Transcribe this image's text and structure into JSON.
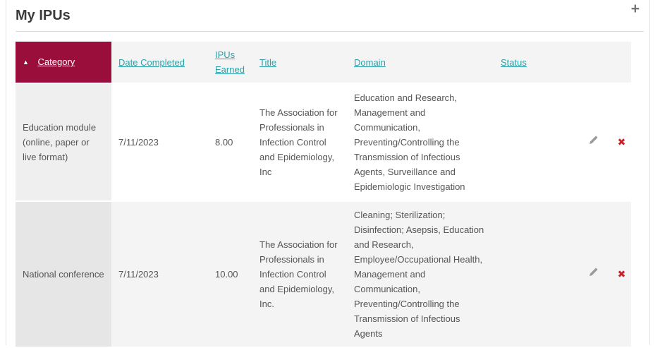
{
  "panel": {
    "title": "My IPUs"
  },
  "icons": {
    "add_glyph": "+",
    "sort_ascending_glyph": "▲",
    "delete_glyph": "✖"
  },
  "table": {
    "headers": {
      "category": "Category",
      "date_completed": "Date Completed",
      "ipus_earned": "IPUs Earned",
      "title": "Title",
      "domain": "Domain",
      "status": "Status"
    },
    "sort": {
      "column": "Category",
      "direction": "ascending"
    },
    "rows": [
      {
        "category": "Education module (online, paper or live format)",
        "date_completed": "7/11/2023",
        "ipus_earned": "8.00",
        "title": "The Association for Professionals in Infection Control and Epidemiology, Inc",
        "domain": "Education and Research, Management and Communication, Preventing/Controlling the Transmission of Infectious Agents, Surveillance and Epidemiologic Investigation",
        "status": ""
      },
      {
        "category": "National conference",
        "date_completed": "7/11/2023",
        "ipus_earned": "10.00",
        "title": "The Association for Professionals in Infection Control and Epidemiology, Inc.",
        "domain": "Cleaning; Sterilization; Disinfection; Asepsis, Education and Research, Employee/Occupational Health, Management and Communication, Preventing/Controlling the Transmission of Infectious Agents",
        "status": ""
      }
    ]
  },
  "colors": {
    "header_accent": "#9a0e3c",
    "link_teal": "#2da1a8",
    "delete_red": "#cb2027",
    "header_bg": "#f4f4f4",
    "title_text": "#3c3c3c",
    "body_text": "#555555"
  }
}
